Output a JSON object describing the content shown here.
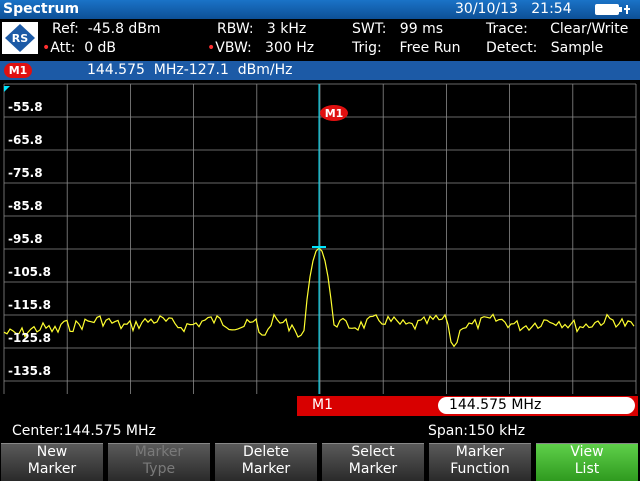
{
  "header": {
    "title": "Spectrum",
    "date": "30/10/13",
    "time": "21:54"
  },
  "settings": {
    "ref": "Ref:  -45.8 dBm",
    "att": "Att:  0 dB",
    "rbw": "RBW:   3 kHz",
    "vbw": "VBW:   300 Hz",
    "swt": "SWT:   99 ms",
    "trig": "Trig:    Free Run",
    "trace": "Trace:     Clear/Write",
    "detect": "Detect:   Sample"
  },
  "marker_bar": {
    "badge": "M1",
    "readout": "144.575  MHz-127.1  dBm/Hz"
  },
  "plot": {
    "y_ticks": [
      "-55.8",
      "-65.8",
      "-75.8",
      "-85.8",
      "-95.8",
      "-105.8",
      "-115.8",
      "-125.8",
      "-135.8"
    ],
    "marker_label": "M1",
    "trace_color": "#ffff30",
    "marker_color": "#00e5ff"
  },
  "marker_result": {
    "label": "M1",
    "value": "144.575 MHz"
  },
  "status": {
    "center": "Center:144.575 MHz",
    "span": "Span:150 kHz"
  },
  "softkeys": [
    {
      "line1": "New",
      "line2": "Marker",
      "state": "normal"
    },
    {
      "line1": "Marker",
      "line2": "Type",
      "state": "disabled"
    },
    {
      "line1": "Delete",
      "line2": "Marker",
      "state": "normal"
    },
    {
      "line1": "Select",
      "line2": "Marker",
      "state": "normal"
    },
    {
      "line1": "Marker",
      "line2": "Function",
      "state": "normal"
    },
    {
      "line1": "View",
      "line2": "List",
      "state": "active"
    }
  ]
}
